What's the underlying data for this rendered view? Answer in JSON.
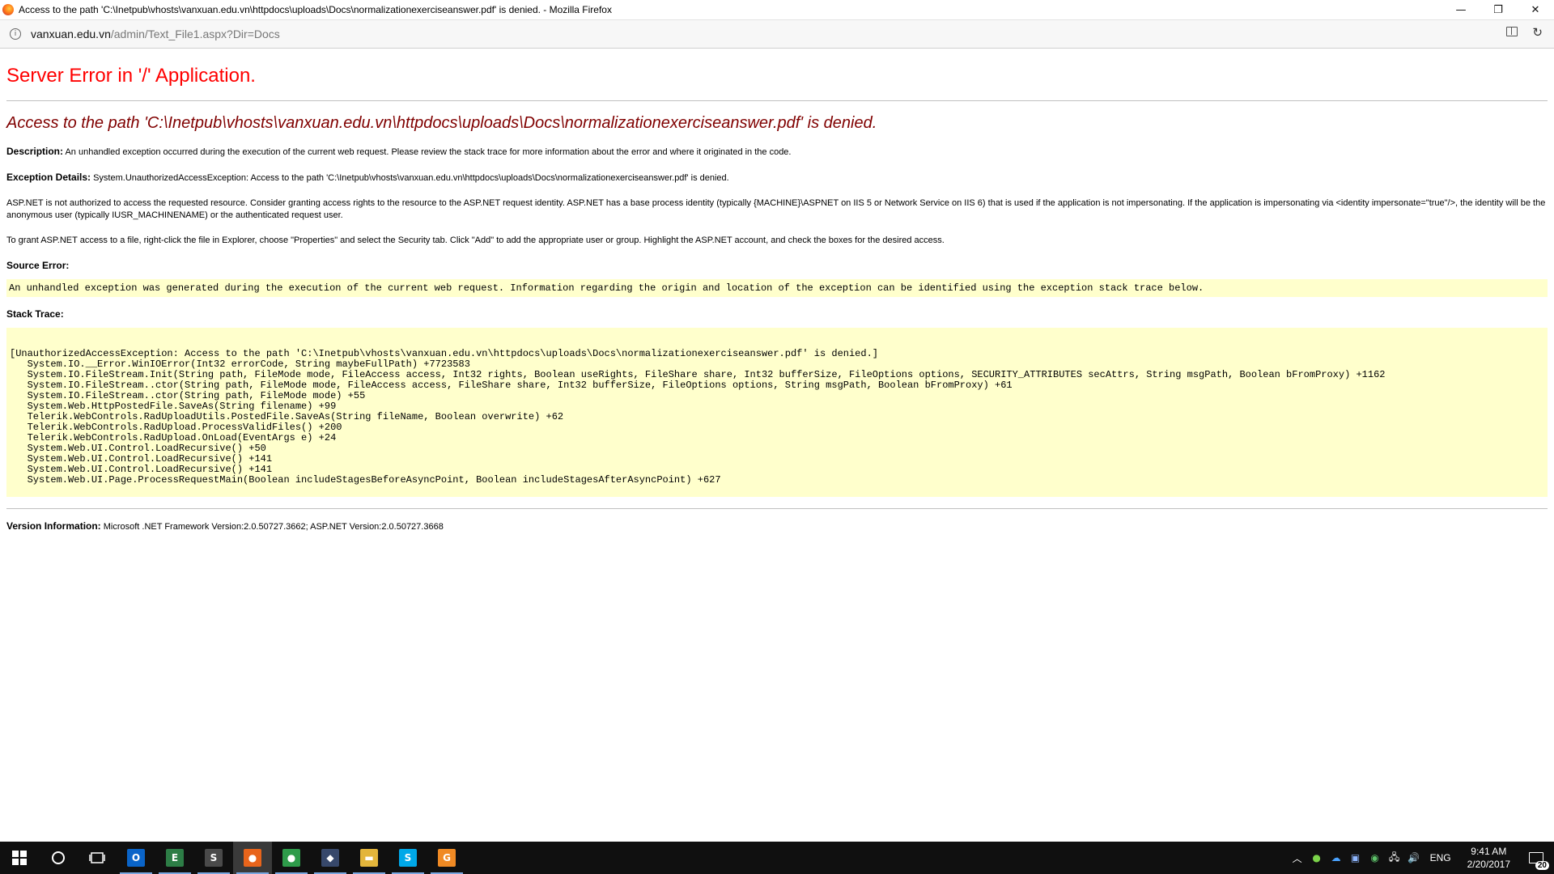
{
  "window": {
    "title": "Access to the path 'C:\\Inetpub\\vhosts\\vanxuan.edu.vn\\httpdocs\\uploads\\Docs\\normalizationexerciseanswer.pdf' is denied. - Mozilla Firefox",
    "minimize_glyph": "—",
    "restore_glyph": "❐",
    "close_glyph": "✕"
  },
  "urlbar": {
    "host": "vanxuan.edu.vn",
    "path": "/admin/Text_File1.aspx?Dir=Docs"
  },
  "page": {
    "error_title": "Server Error in '/' Application.",
    "error_subtitle": "Access to the path 'C:\\Inetpub\\vhosts\\vanxuan.edu.vn\\httpdocs\\uploads\\Docs\\normalizationexerciseanswer.pdf' is denied.",
    "description_label": "Description:",
    "description_text": " An unhandled exception occurred during the execution of the current web request. Please review the stack trace for more information about the error and where it originated in the code.",
    "exception_label": "Exception Details:",
    "exception_text": " System.UnauthorizedAccessException: Access to the path 'C:\\Inetpub\\vhosts\\vanxuan.edu.vn\\httpdocs\\uploads\\Docs\\normalizationexerciseanswer.pdf' is denied.",
    "aspnet_note": "ASP.NET is not authorized to access the requested resource. Consider granting access rights to the resource to the ASP.NET request identity. ASP.NET has a base process identity (typically {MACHINE}\\ASPNET on IIS 5 or Network Service on IIS 6) that is used if the application is not impersonating. If the application is impersonating via <identity impersonate=\"true\"/>, the identity will be the anonymous user (typically IUSR_MACHINENAME) or the authenticated request user.",
    "grant_note": "To grant ASP.NET access to a file, right-click the file in Explorer, choose \"Properties\" and select the Security tab. Click \"Add\" to add the appropriate user or group. Highlight the ASP.NET account, and check the boxes for the desired access.",
    "source_error_label": "Source Error:",
    "source_error_text": "An unhandled exception was generated during the execution of the current web request. Information regarding the origin and location of the exception can be identified using the exception stack trace below.",
    "stack_trace_label": "Stack Trace:",
    "stack_lines": [
      "[UnauthorizedAccessException: Access to the path 'C:\\Inetpub\\vhosts\\vanxuan.edu.vn\\httpdocs\\uploads\\Docs\\normalizationexerciseanswer.pdf' is denied.]",
      "   System.IO.__Error.WinIOError(Int32 errorCode, String maybeFullPath) +7723583",
      "   System.IO.FileStream.Init(String path, FileMode mode, FileAccess access, Int32 rights, Boolean useRights, FileShare share, Int32 bufferSize, FileOptions options, SECURITY_ATTRIBUTES secAttrs, String msgPath, Boolean bFromProxy) +1162",
      "   System.IO.FileStream..ctor(String path, FileMode mode, FileAccess access, FileShare share, Int32 bufferSize, FileOptions options, String msgPath, Boolean bFromProxy) +61",
      "   System.IO.FileStream..ctor(String path, FileMode mode) +55",
      "   System.Web.HttpPostedFile.SaveAs(String filename) +99",
      "   Telerik.WebControls.RadUploadUtils.PostedFile.SaveAs(String fileName, Boolean overwrite) +62",
      "   Telerik.WebControls.RadUpload.ProcessValidFiles() +200",
      "   Telerik.WebControls.RadUpload.OnLoad(EventArgs e) +24",
      "   System.Web.UI.Control.LoadRecursive() +50",
      "   System.Web.UI.Control.LoadRecursive() +141",
      "   System.Web.UI.Control.LoadRecursive() +141",
      "   System.Web.UI.Page.ProcessRequestMain(Boolean includeStagesBeforeAsyncPoint, Boolean includeStagesAfterAsyncPoint) +627"
    ],
    "version_label": "Version Information:",
    "version_text": " Microsoft .NET Framework Version:2.0.50727.3662; ASP.NET Version:2.0.50727.3668"
  },
  "taskbar": {
    "apps": [
      {
        "name": "outlook-icon",
        "glyph": "O",
        "color": "#0a64c8",
        "state": "open"
      },
      {
        "name": "editor-icon",
        "glyph": "E",
        "color": "#2d7d46",
        "state": "open"
      },
      {
        "name": "sublime-icon",
        "glyph": "S",
        "color": "#4a4a4a",
        "state": "open"
      },
      {
        "name": "firefox-icon",
        "glyph": "●",
        "color": "#e8641b",
        "state": "active"
      },
      {
        "name": "chrome-icon",
        "glyph": "●",
        "color": "#2e9b4a",
        "state": "open"
      },
      {
        "name": "sql-icon",
        "glyph": "◆",
        "color": "#37486b",
        "state": "open"
      },
      {
        "name": "file-explorer-icon",
        "glyph": "▬",
        "color": "#e3b53b",
        "state": "open"
      },
      {
        "name": "skype-icon",
        "glyph": "S",
        "color": "#00a8e8",
        "state": "open"
      },
      {
        "name": "app-orange-icon",
        "glyph": "G",
        "color": "#f08a24",
        "state": "open"
      }
    ],
    "language": "ENG",
    "time": "9:41 AM",
    "date": "2/20/2017",
    "notification_count": "20"
  }
}
